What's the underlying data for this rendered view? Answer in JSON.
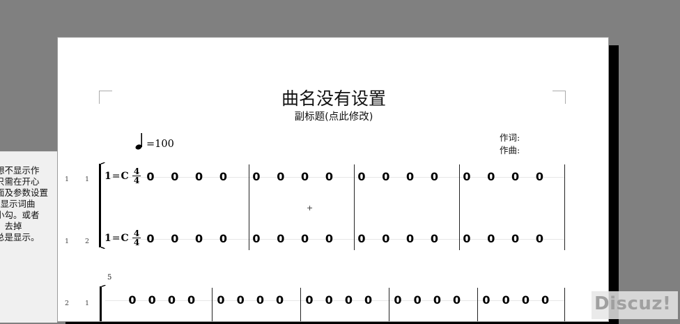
{
  "side_panel": {
    "lines": [
      "想不显示作",
      "只需在开心",
      "面及参数设置",
      "“显示词曲",
      "小勾。或者",
      "，去掉",
      "总是显示。"
    ]
  },
  "score": {
    "title": "曲名没有设置",
    "subtitle": "副标题(点此修改)",
    "tempo": "=100",
    "lyricist": "作词:",
    "composer": "作曲:",
    "key": {
      "prefix": "1",
      "eq": "=",
      "note": "C"
    },
    "time_signature": {
      "top": "4",
      "bottom": "4"
    },
    "systems": [
      {
        "row_labels": [
          [
            "1",
            "1"
          ],
          [
            "1",
            "2"
          ]
        ],
        "staves": [
          {
            "measures": [
              [
                "0",
                "0",
                "0",
                "0"
              ],
              [
                "0",
                "0",
                "0",
                "0"
              ],
              [
                "0",
                "0",
                "0",
                "0"
              ],
              [
                "0",
                "0",
                "0",
                "0"
              ]
            ]
          },
          {
            "measures": [
              [
                "0",
                "0",
                "0",
                "0"
              ],
              [
                "0",
                "0",
                "0",
                "0"
              ],
              [
                "0",
                "0",
                "0",
                "0"
              ],
              [
                "0",
                "0",
                "0",
                "0"
              ]
            ]
          }
        ]
      },
      {
        "row_labels": [
          [
            "2",
            "1"
          ]
        ],
        "measure_start": "5",
        "staves": [
          {
            "measures": [
              [
                "0",
                "0",
                "0",
                "0"
              ],
              [
                "0",
                "0",
                "0",
                "0"
              ],
              [
                "0",
                "0",
                "0",
                "0"
              ],
              [
                "0",
                "0",
                "0",
                "0"
              ],
              [
                "0",
                "0",
                "0",
                "0"
              ]
            ]
          }
        ]
      }
    ],
    "cursor": "+"
  },
  "watermark": "Discuz!"
}
